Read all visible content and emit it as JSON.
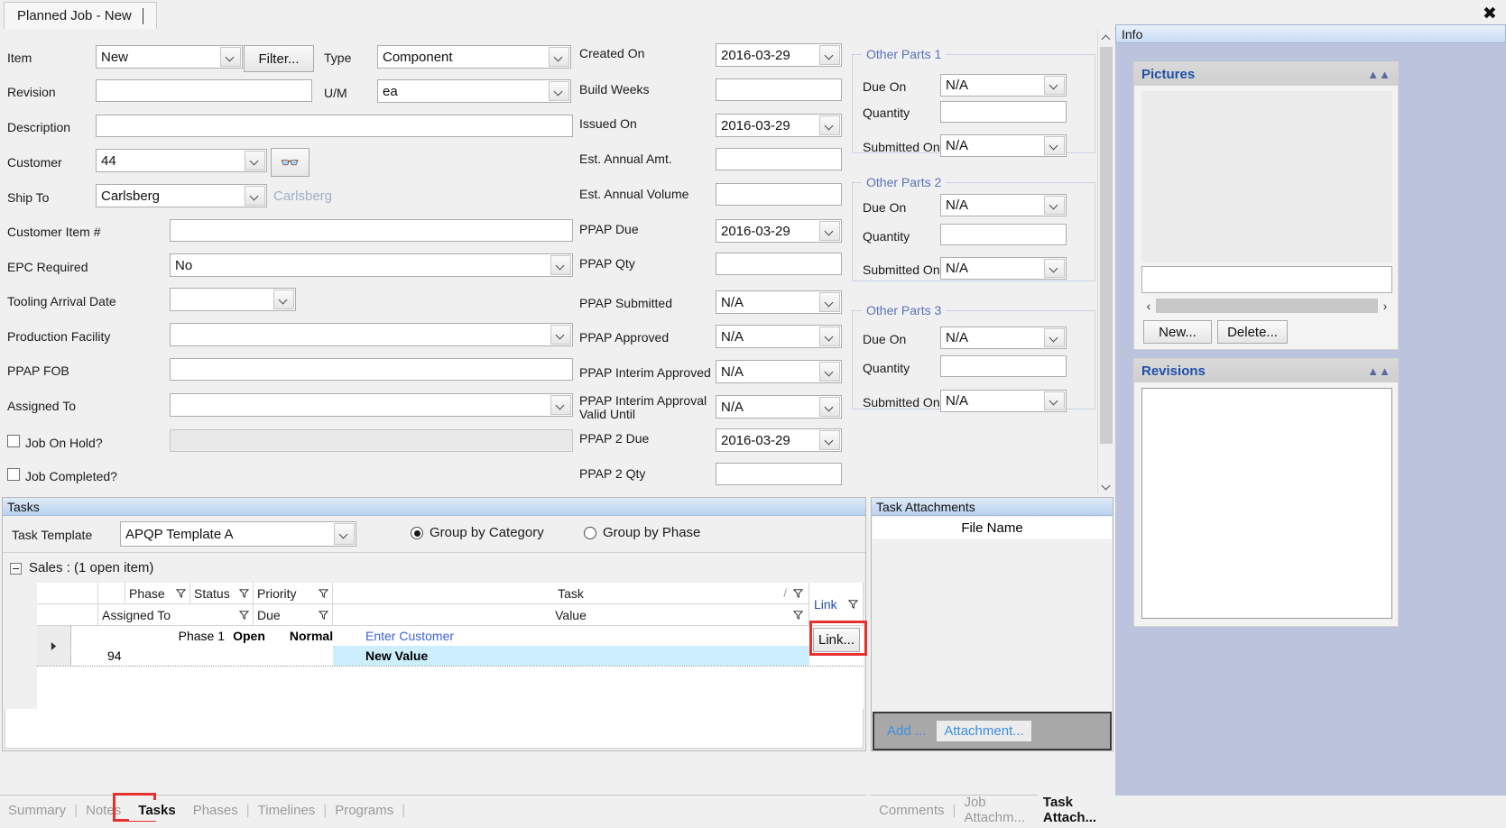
{
  "window": {
    "tab_title": "Planned Job - New",
    "close_icon": "close-icon"
  },
  "form": {
    "left": [
      {
        "label": "Item",
        "kind": "combo",
        "value": "New"
      },
      {
        "label": "Revision",
        "kind": "text",
        "value": ""
      },
      {
        "label": "Description",
        "kind": "text",
        "value": ""
      },
      {
        "label": "Customer",
        "kind": "combo",
        "value": "44"
      },
      {
        "label": "Ship To",
        "kind": "combo",
        "value": "Carlsberg"
      },
      {
        "label": "Customer Item #",
        "kind": "text",
        "value": ""
      },
      {
        "label": "EPC Required",
        "kind": "combo",
        "value": "No"
      },
      {
        "label": "Tooling Arrival Date",
        "kind": "combo",
        "value": ""
      },
      {
        "label": "Production Facility",
        "kind": "combo",
        "value": ""
      },
      {
        "label": "PPAP FOB",
        "kind": "text",
        "value": ""
      },
      {
        "label": "Assigned To",
        "kind": "combo",
        "value": ""
      },
      {
        "label": "Job On Hold?",
        "kind": "check",
        "value": ""
      },
      {
        "label": "Job Completed?",
        "kind": "check",
        "value": ""
      }
    ],
    "filter_button": "Filter...",
    "ship_to_note": "Carlsberg",
    "search_icon": "binoculars-icon",
    "type_label": "Type",
    "type_value": "Component",
    "um_label": "U/M",
    "um_value": "ea",
    "middle": [
      {
        "label": "Created On",
        "kind": "combo",
        "value": "2016-03-29"
      },
      {
        "label": "Build Weeks",
        "kind": "text",
        "value": ""
      },
      {
        "label": "Issued On",
        "kind": "combo",
        "value": "2016-03-29"
      },
      {
        "label": "Est. Annual Amt.",
        "kind": "text",
        "value": ""
      },
      {
        "label": "Est. Annual Volume",
        "kind": "text",
        "value": ""
      },
      {
        "label": "PPAP Due",
        "kind": "combo",
        "value": "2016-03-29"
      },
      {
        "label": "PPAP Qty",
        "kind": "text",
        "value": ""
      },
      {
        "label": "PPAP Submitted",
        "kind": "combo",
        "value": "N/A"
      },
      {
        "label": "PPAP Approved",
        "kind": "combo",
        "value": "N/A"
      },
      {
        "label": "PPAP Interim Approved",
        "kind": "combo",
        "value": "N/A"
      },
      {
        "label": "PPAP Interim Approval Valid Until",
        "kind": "combo",
        "value": "N/A"
      },
      {
        "label": "PPAP 2 Due",
        "kind": "combo",
        "value": "2016-03-29"
      },
      {
        "label": "PPAP 2 Qty",
        "kind": "text",
        "value": ""
      }
    ],
    "other_parts": [
      {
        "title": "Other Parts 1",
        "fields": [
          {
            "label": "Due On",
            "kind": "combo",
            "value": "N/A"
          },
          {
            "label": "Quantity",
            "kind": "text",
            "value": ""
          },
          {
            "label": "Submitted On",
            "kind": "combo",
            "value": "N/A"
          }
        ]
      },
      {
        "title": "Other Parts 2",
        "fields": [
          {
            "label": "Due On",
            "kind": "combo",
            "value": "N/A"
          },
          {
            "label": "Quantity",
            "kind": "text",
            "value": ""
          },
          {
            "label": "Submitted On",
            "kind": "combo",
            "value": "N/A"
          }
        ]
      },
      {
        "title": "Other Parts 3",
        "fields": [
          {
            "label": "Due On",
            "kind": "combo",
            "value": "N/A"
          },
          {
            "label": "Quantity",
            "kind": "text",
            "value": ""
          },
          {
            "label": "Submitted On",
            "kind": "combo",
            "value": "N/A"
          }
        ]
      }
    ]
  },
  "info": {
    "header": "Info",
    "pictures": {
      "title": "Pictures",
      "collapse_icon": "chevron-up-icon",
      "caption_value": "",
      "prev_icon": "chevron-left-icon",
      "next_icon": "chevron-right-icon",
      "new_button": "New...",
      "delete_button": "Delete..."
    },
    "revisions": {
      "title": "Revisions",
      "collapse_icon": "chevron-up-icon"
    }
  },
  "tasks": {
    "header": "Tasks",
    "template_label": "Task Template",
    "template_value": "APQP Template A",
    "group_by_category": "Group by Category",
    "group_by_phase": "Group by Phase",
    "group_selected": "category",
    "group_row": "Sales : (1 open item)",
    "group_expand_icon": "minus-box-icon",
    "columns_top": [
      "Phase",
      "Status",
      "Priority",
      "Task",
      "Link"
    ],
    "columns_bottom": [
      "Assigned To",
      "Due",
      "Value"
    ],
    "row": {
      "indicator_icon": "row-selector-icon",
      "id": "94",
      "phase": "Phase 1",
      "status": "Open",
      "priority": "Normal",
      "task": "Enter Customer",
      "value": "New Value",
      "link_button": "Link..."
    }
  },
  "attachments": {
    "header": "Task Attachments",
    "column_file_name": "File Name",
    "add_button": "Add ...",
    "attachment_button": "Attachment..."
  },
  "bottom_tabs_left": [
    {
      "label": "Summary",
      "active": false
    },
    {
      "label": "Notes",
      "active": false
    },
    {
      "label": "Tasks",
      "active": true
    },
    {
      "label": "Phases",
      "active": false
    },
    {
      "label": "Timelines",
      "active": false
    },
    {
      "label": "Programs",
      "active": false
    }
  ],
  "bottom_tabs_right": [
    {
      "label": "Comments",
      "active": false
    },
    {
      "label": "Job Attachm...",
      "active": false
    },
    {
      "label": "Task Attach...",
      "active": true
    }
  ],
  "colors": {
    "accent_blue": "#1f4fa8",
    "group_title": "#5b71ba",
    "link_text": "#3d5fd6",
    "highlight_row": "#cdeefc",
    "annotation_red": "#e8312f"
  }
}
